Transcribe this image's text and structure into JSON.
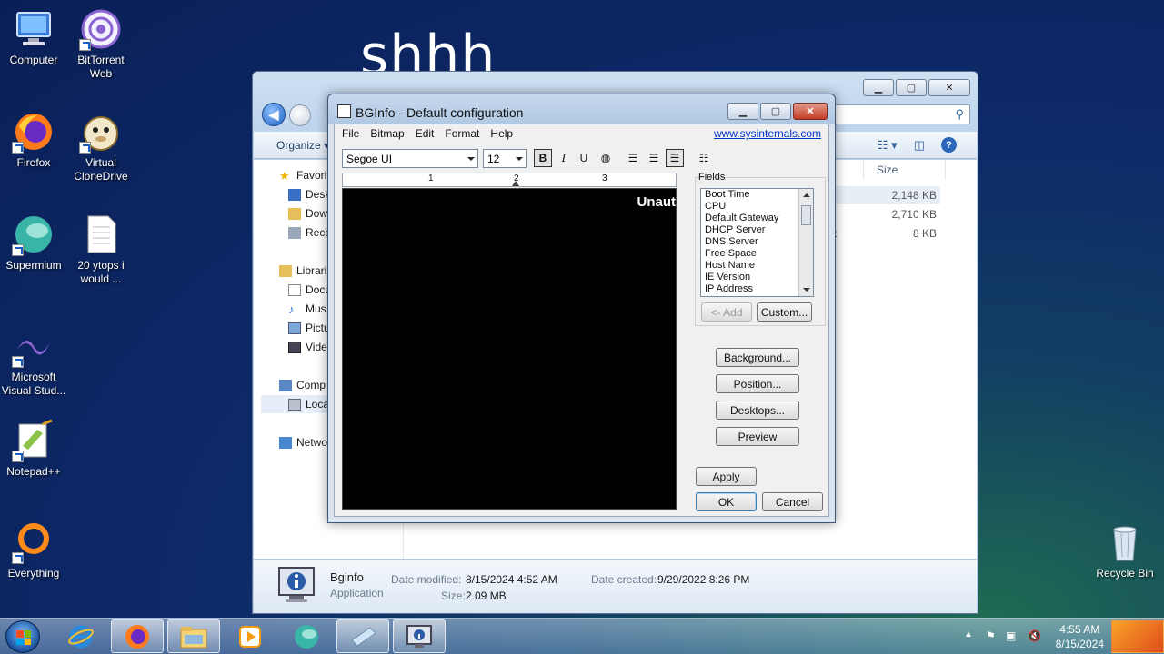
{
  "desktop": {
    "wallpaper_text": "shhh",
    "icons": [
      {
        "label": "Computer",
        "icon": "computer-icon"
      },
      {
        "label": "BitTorrent Web",
        "icon": "bittorrent-icon"
      },
      {
        "label": "Firefox",
        "icon": "firefox-icon"
      },
      {
        "label": "Virtual CloneDrive",
        "icon": "clonedrive-icon"
      },
      {
        "label": "Supermium",
        "icon": "supermium-icon"
      },
      {
        "label": "20 ytops i would ...",
        "icon": "text-document-icon"
      },
      {
        "label": "Microsoft Visual Stud...",
        "icon": "visual-studio-icon"
      },
      {
        "label": "Notepad++",
        "icon": "notepadpp-icon"
      },
      {
        "label": "Everything",
        "icon": "everything-icon"
      },
      {
        "label": "Recycle Bin",
        "icon": "recycle-bin-icon"
      }
    ]
  },
  "explorer": {
    "organize_label": "Organize ▾",
    "column_size": "Size",
    "nav": {
      "favorites": "Favorit",
      "desktop": "Desk",
      "downloads": "Dow",
      "recent": "Rece",
      "libraries": "Librari",
      "documents": "Docu",
      "music": "Mus",
      "pictures": "Pictu",
      "videos": "Vide",
      "computer": "Comp",
      "local": "Loca",
      "network": "Netwo"
    },
    "sizes": [
      "2,148 KB",
      "2,710 KB",
      "8 KB"
    ],
    "partial_text": "t",
    "details": {
      "name": "Bginfo",
      "type": "Application",
      "date_modified_label": "Date modified:",
      "date_modified": "8/15/2024 4:52 AM",
      "date_created_label": "Date created:",
      "date_created": "9/29/2022 8:26 PM",
      "size_label": "Size:",
      "size": "2.09 MB"
    }
  },
  "bginfo": {
    "title": "BGInfo - Default configuration",
    "menu": [
      "File",
      "Bitmap",
      "Edit",
      "Format",
      "Help"
    ],
    "link": "www.sysinternals.com",
    "font": "Segoe UI",
    "font_size": "12",
    "format_buttons": {
      "bold": "B",
      "italic": "I",
      "underline": "U"
    },
    "ruler_numbers": [
      "1",
      "2",
      "3"
    ],
    "canvas_text": "Unaut",
    "fields_label": "Fields",
    "fields": [
      "Boot Time",
      "CPU",
      "Default Gateway",
      "DHCP Server",
      "DNS Server",
      "Free Space",
      "Host Name",
      "IE Version",
      "IP Address"
    ],
    "add_button": "<- Add",
    "custom_button": "Custom...",
    "background_button": "Background...",
    "position_button": "Position...",
    "desktops_button": "Desktops...",
    "preview_button": "Preview",
    "apply_button": "Apply",
    "ok_button": "OK",
    "cancel_button": "Cancel"
  },
  "taskbar": {
    "time": "4:55 AM",
    "date": "8/15/2024"
  }
}
